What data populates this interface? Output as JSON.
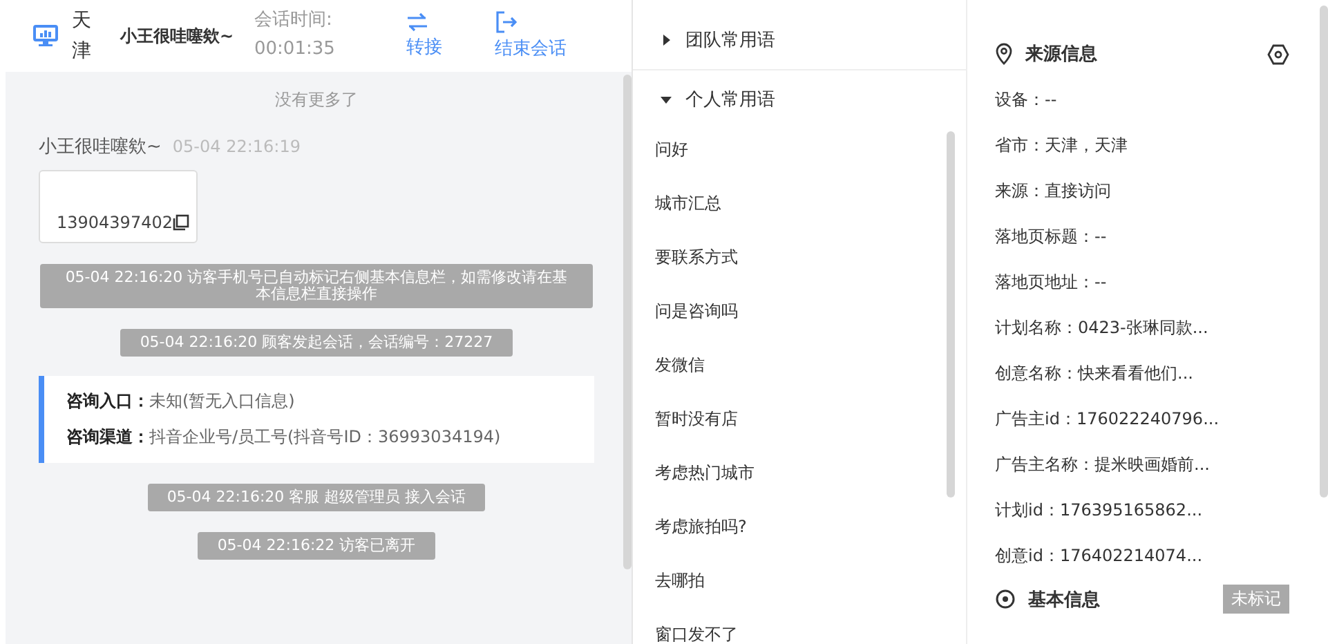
{
  "chat_header": {
    "city": "天津",
    "visitor_name": "小王很哇噻欸~",
    "duration_label": "会话时间:",
    "duration": "00:01:35",
    "actions": [
      {
        "kind": "transfer",
        "label": "转接"
      },
      {
        "kind": "end",
        "label": "结束会话"
      }
    ]
  },
  "chat": {
    "no_more": "没有更多了",
    "messages": [
      {
        "kind": "visitor",
        "sender": "小王很哇噻欸~",
        "time": "05-04 22:16:19",
        "text": "13904397402"
      },
      {
        "kind": "system",
        "text": "05-04 22:16:20 访客手机号已自动标记右侧基本信息栏，如需修改请在基本信息栏直接操作"
      },
      {
        "kind": "system",
        "text": "05-04 22:16:20 顾客发起会话，会话编号：27227"
      },
      {
        "kind": "info",
        "rows": [
          {
            "label": "咨询入口：",
            "value": "未知(暂无入口信息)"
          },
          {
            "label": "咨询渠道：",
            "value": "抖音企业号/员工号(抖音号ID：36993034194)"
          }
        ]
      },
      {
        "kind": "system",
        "text": "05-04 22:16:20 客服 超级管理员 接入会话"
      },
      {
        "kind": "system",
        "text": "05-04 22:16:22 访客已离开"
      }
    ]
  },
  "phrases": {
    "groups": [
      {
        "title": "团队常用语",
        "expanded": false
      },
      {
        "title": "个人常用语",
        "expanded": true,
        "items": [
          "问好",
          "城市汇总",
          "要联系方式",
          "问是咨询吗",
          "发微信",
          "暂时没有店",
          "考虑热门城市",
          "考虑旅拍吗?",
          "去哪拍",
          "窗口发不了"
        ]
      }
    ]
  },
  "source_info": {
    "title": "来源信息",
    "fields": [
      "设备：--",
      "省市：天津，天津",
      "来源：直接访问",
      "落地页标题：--",
      "落地页地址：--",
      "计划名称：0423-张琳同款...",
      "创意名称：快来看看他们...",
      "广告主id：176022240796...",
      "广告主名称：提米映画婚前...",
      "计划id：176395165862...",
      "创意id：176402214074..."
    ]
  },
  "basic_info": {
    "title": "基本信息",
    "badge": "未标记"
  }
}
